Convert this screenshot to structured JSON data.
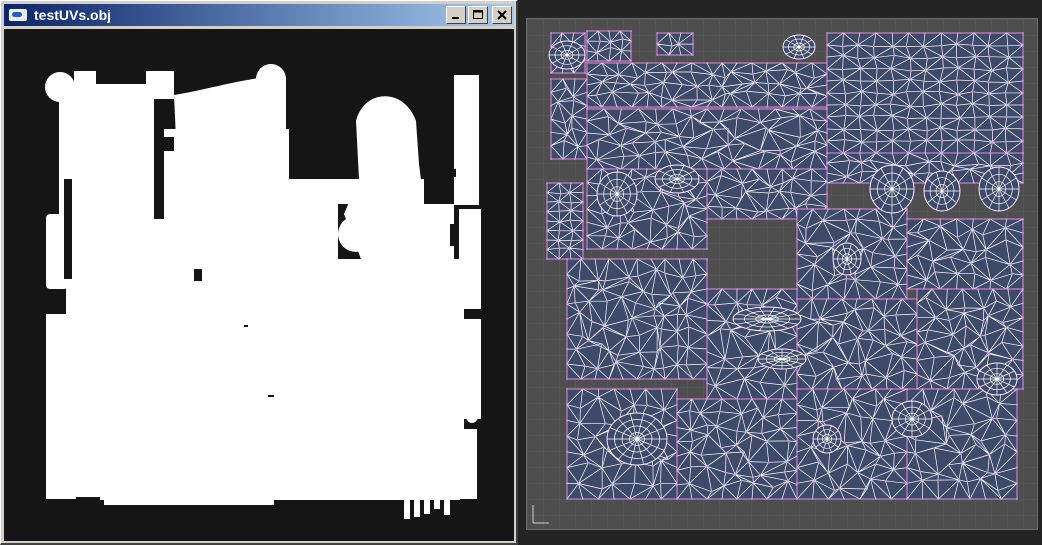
{
  "window": {
    "title": "testUVs.obj",
    "icon": "obj-file-icon",
    "buttons": {
      "minimize": "_",
      "maximize": "□",
      "close": "X"
    }
  },
  "colors": {
    "desktop_bg": "#242424",
    "titlebar_start": "#0a246a",
    "titlebar_end": "#a6caf0",
    "mask_bg": "#151515",
    "mask_fg": "#ffffff",
    "viewport_bg": "#4e4e4e",
    "uv_fill": "#3e4a6a",
    "uv_wire": "#ffffff",
    "uv_vertex": "#e38ce6"
  }
}
